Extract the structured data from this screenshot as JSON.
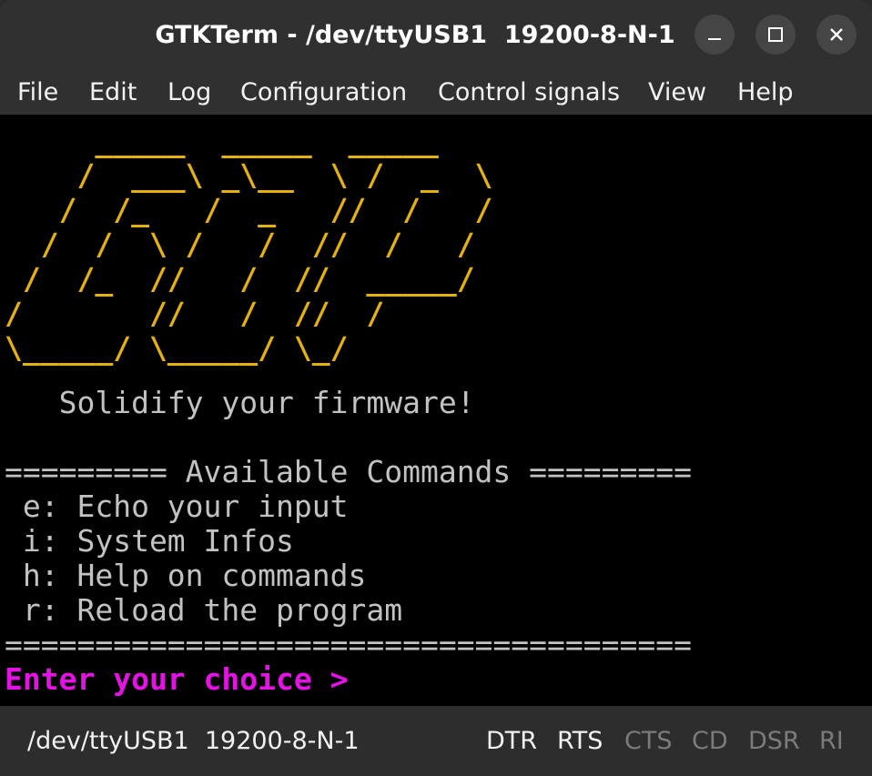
{
  "window": {
    "title": "GTKTerm - /dev/ttyUSB1  19200-8-N-1"
  },
  "icons": {
    "minimize": "minimize-icon",
    "maximize": "maximize-icon",
    "close": "close-icon"
  },
  "menu": {
    "items": [
      "File",
      "Edit",
      "Log",
      "Configuration",
      "Control signals",
      "View",
      "Help"
    ]
  },
  "terminal": {
    "logo_lines": [
      "     _____  _____  _____ ",
      "    /  ___\\ _\\__  \\ /  _  \\",
      "   /  /_   /  _   //  /   /",
      "  /  /  \\ /   /  //  /   / ",
      " /  /_  //   /  //  _____/ ",
      "/       //   /  //  /       ",
      "\\_____/ \\_____/ \\_/        "
    ],
    "tagline": "   Solidify your firmware!",
    "header": "========= Available Commands =========",
    "commands": [
      " e: Echo your input",
      " i: System Infos",
      " h: Help on commands",
      " r: Reload the program"
    ],
    "footer": "======================================",
    "prompt": "Enter your choice >"
  },
  "status": {
    "port": "/dev/ttyUSB1  19200-8-N-1",
    "signals": [
      {
        "label": "DTR",
        "active": true
      },
      {
        "label": "RTS",
        "active": true
      },
      {
        "label": "CTS",
        "active": false
      },
      {
        "label": "CD",
        "active": false
      },
      {
        "label": "DSR",
        "active": false
      },
      {
        "label": "RI",
        "active": false
      }
    ]
  },
  "colors": {
    "logo": "#e5b10c",
    "text": "#c2c2c2",
    "prompt": "#e512e5",
    "background": "#000000",
    "chrome": "#303030",
    "signal_inactive": "#7b7b7b"
  }
}
